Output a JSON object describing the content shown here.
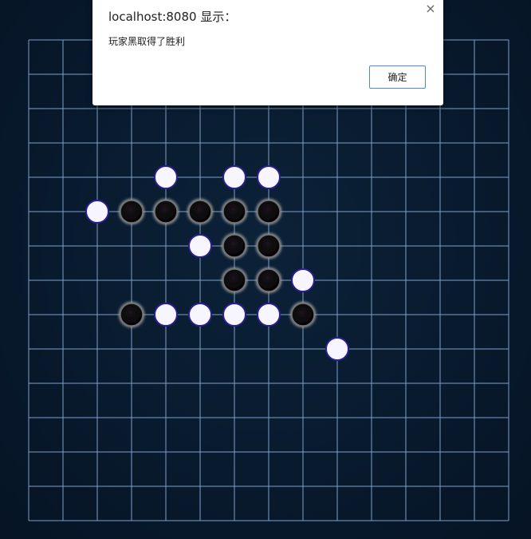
{
  "board": {
    "size": 15,
    "line_color": "#7f9fc6",
    "background_color": "#0a1c30",
    "stones": [
      {
        "color": "white",
        "col": 4,
        "row": 4
      },
      {
        "color": "white",
        "col": 6,
        "row": 4
      },
      {
        "color": "white",
        "col": 7,
        "row": 4
      },
      {
        "color": "white",
        "col": 2,
        "row": 5
      },
      {
        "color": "black",
        "col": 3,
        "row": 5
      },
      {
        "color": "black",
        "col": 4,
        "row": 5
      },
      {
        "color": "black",
        "col": 5,
        "row": 5
      },
      {
        "color": "black",
        "col": 6,
        "row": 5
      },
      {
        "color": "black",
        "col": 7,
        "row": 5
      },
      {
        "color": "white",
        "col": 5,
        "row": 6
      },
      {
        "color": "black",
        "col": 6,
        "row": 6
      },
      {
        "color": "black",
        "col": 7,
        "row": 6
      },
      {
        "color": "black",
        "col": 6,
        "row": 7
      },
      {
        "color": "black",
        "col": 7,
        "row": 7
      },
      {
        "color": "white",
        "col": 8,
        "row": 7
      },
      {
        "color": "black",
        "col": 3,
        "row": 8
      },
      {
        "color": "white",
        "col": 4,
        "row": 8
      },
      {
        "color": "white",
        "col": 5,
        "row": 8
      },
      {
        "color": "white",
        "col": 6,
        "row": 8
      },
      {
        "color": "white",
        "col": 7,
        "row": 8
      },
      {
        "color": "black",
        "col": 8,
        "row": 8
      },
      {
        "color": "white",
        "col": 9,
        "row": 9
      }
    ]
  },
  "alert": {
    "title": "localhost:8080 显示：",
    "message": "玩家黑取得了胜利",
    "ok_label": "确定",
    "close_symbol": "×"
  },
  "colors": {
    "white_stone": "#f7f6ff",
    "white_stone_ring": "#2a1f8f",
    "black_stone": "#060406",
    "black_stone_glow": "#9a9a9a",
    "button_border": "#4a8ad9"
  }
}
